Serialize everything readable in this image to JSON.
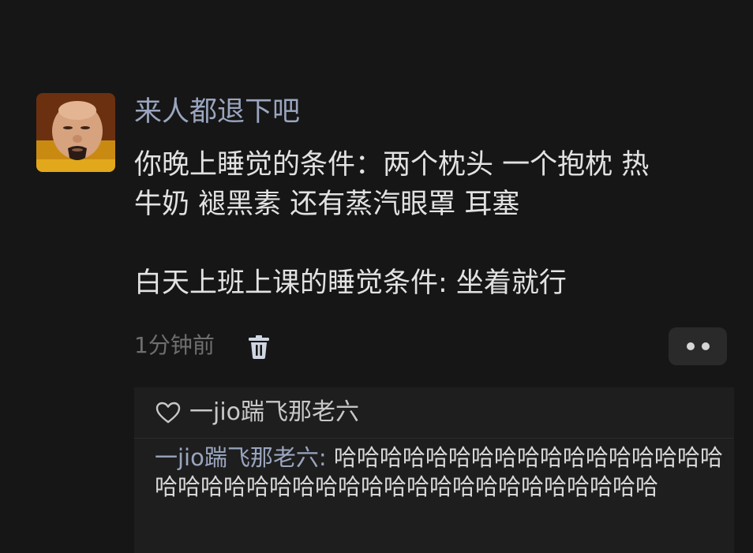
{
  "post": {
    "username": "来人都退下吧",
    "text_line1": "你晚上睡觉的条件：两个枕头 一个抱枕 热",
    "text_line2": "牛奶 褪黑素 还有蒸汽眼罩 耳塞",
    "text_line3": "白天上班上课的睡觉条件: 坐着就行",
    "timestamp": "1分钟前",
    "icons": {
      "delete": "trash-icon",
      "more": "more-dots-icon"
    }
  },
  "reply_panel": {
    "like": {
      "icon": "heart-outline-icon",
      "name": "一jio踹飞那老六"
    },
    "comment": {
      "author": "一jio踹飞那老六:",
      "text": " 哈哈哈哈哈哈哈哈哈哈哈哈哈哈哈哈哈哈哈哈哈哈哈哈哈哈哈哈哈哈哈哈哈哈哈哈哈哈哈"
    }
  },
  "colors": {
    "background": "#161616",
    "username": "#9aa5bf",
    "text": "#e2e2e2",
    "muted": "#6f6f6f",
    "panel": "#1e1e1e"
  }
}
